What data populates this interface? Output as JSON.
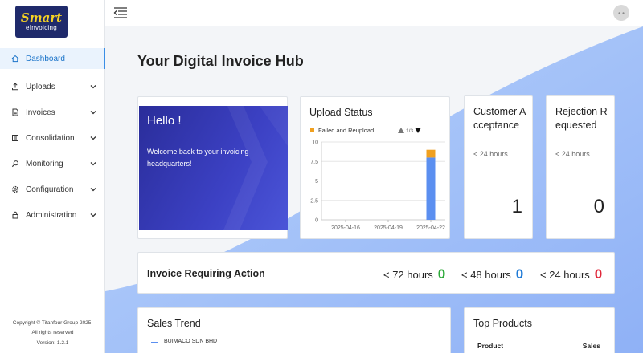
{
  "logo": {
    "line1": "Smart",
    "line2": "eInvoicing"
  },
  "sidebar": {
    "items": [
      {
        "label": "Dashboard",
        "icon": "home-icon",
        "active": true
      },
      {
        "label": "Uploads",
        "icon": "upload-icon"
      },
      {
        "label": "Invoices",
        "icon": "document-icon"
      },
      {
        "label": "Consolidation",
        "icon": "list-icon"
      },
      {
        "label": "Monitoring",
        "icon": "search-icon"
      },
      {
        "label": "Configuration",
        "icon": "gear-icon"
      },
      {
        "label": "Administration",
        "icon": "lock-icon"
      }
    ]
  },
  "footer": {
    "line1": "Copyright © Titanfour Group 2025.",
    "line2": "All rights reserved",
    "line3": "Version: 1.2.1"
  },
  "topbar": {
    "avatar_text": "• •"
  },
  "page": {
    "title": "Your Digital Invoice Hub"
  },
  "hello": {
    "title": "Hello !",
    "text": "Welcome back to your invoicing headquarters!"
  },
  "upload": {
    "title": "Upload Status",
    "legend_label": "Failed and Reupload",
    "pager": "1/3"
  },
  "customer": {
    "title": "Customer Acceptance",
    "sub": "< 24 hours",
    "value": "1"
  },
  "rejection": {
    "title": "Rejection Requested",
    "sub": "< 24 hours",
    "value": "0"
  },
  "action": {
    "title": "Invoice Requiring Action",
    "items": [
      {
        "label": "< 72 hours",
        "value": "0",
        "color": "#2eaa3a"
      },
      {
        "label": "< 48 hours",
        "value": "0",
        "color": "#1f7ad6"
      },
      {
        "label": "< 24 hours",
        "value": "0",
        "color": "#e0283a"
      }
    ]
  },
  "sales": {
    "title": "Sales Trend",
    "legend": "BUIMACO SDN BHD"
  },
  "products": {
    "title": "Top Products",
    "col1": "Product",
    "col2": "Sales"
  },
  "chart_data": {
    "type": "bar",
    "categories": [
      "2025-04-16",
      "2025-04-19",
      "2025-04-22"
    ],
    "x_ticks": [
      "2025-04-16",
      "2025-04-19",
      "2025-04-22"
    ],
    "y_ticks": [
      "0",
      "2.5",
      "5",
      "7.5",
      "10"
    ],
    "ylim": [
      0,
      10
    ],
    "series": [
      {
        "name": "Failed and Reupload",
        "color": "#f0a020",
        "values": [
          0,
          0,
          1
        ]
      },
      {
        "color": "#5b8ff0",
        "values": [
          0,
          0,
          8
        ]
      }
    ],
    "stacked": true,
    "grid": true,
    "legend": "top-left"
  },
  "colors": {
    "accent": "#1a73c9",
    "hello_bg": "#3c41c4"
  }
}
